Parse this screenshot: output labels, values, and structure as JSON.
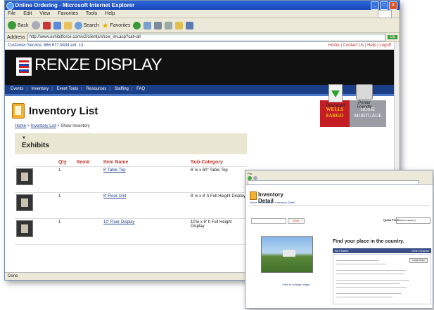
{
  "browser": {
    "window_title": "Online Ordering - Microsoft Internet Explorer",
    "menu": [
      "File",
      "Edit",
      "View",
      "Favorites",
      "Tools",
      "Help"
    ],
    "toolbar": {
      "back": "Back",
      "search": "Search",
      "favorites": "Favorites"
    },
    "address_label": "Address",
    "address_value": "http://www.exhibitforce.com/v2/clients/show_inv.asp?cat=all",
    "go_label": "Go",
    "status": "Done"
  },
  "site": {
    "customer_service": "Customer Service: 866.677.9434 ext. 13",
    "top_links": "Home | Contact Us | Help | Logoff",
    "brand": "RENZE DISPLAY",
    "nav": [
      "Events",
      "Inventory",
      "Event Tools",
      "Resources",
      "Staffing",
      "FAQ"
    ]
  },
  "page": {
    "title": "Inventory List",
    "breadcrumb": {
      "home": "Home",
      "inventory_list": "Inventory List",
      "current": "Show Inventory",
      "sep": " > "
    },
    "partner_left": "WELLS FARGO",
    "partner_right": "HOME MORTGAGE",
    "download_label": "Download",
    "printer_label": "Printer Friendly",
    "section_arrow": "▼",
    "section_title": "Exhibits"
  },
  "table": {
    "headers": [
      "Qty",
      "Item#",
      "Item Name",
      "Sub-Category"
    ],
    "rows": [
      {
        "qty": "1",
        "item_no": "",
        "name": "6' Table Top",
        "sub": "6' w x 60\" Table Top"
      },
      {
        "qty": "1",
        "item_no": "",
        "name": "8' Floor Unit",
        "sub": "8' w x 8' h Full Height Display"
      },
      {
        "qty": "1",
        "item_no": "",
        "name": "10' Floor Display",
        "sub": "10'w x 8' h Full Height Display"
      }
    ]
  },
  "detail_window": {
    "title": "Inventory Detail",
    "breadcrumb": "Home > Inventory > Inventory Detail",
    "go_label": "Go ▸",
    "quick_find_label": "Quick Find:",
    "quick_find_value": "(Select a Category)",
    "find_heading": "Find your place in the country.",
    "table_left": "Item Name",
    "table_right": "Order Options",
    "caption": "Click to enlarge image",
    "button": "Create Order"
  }
}
